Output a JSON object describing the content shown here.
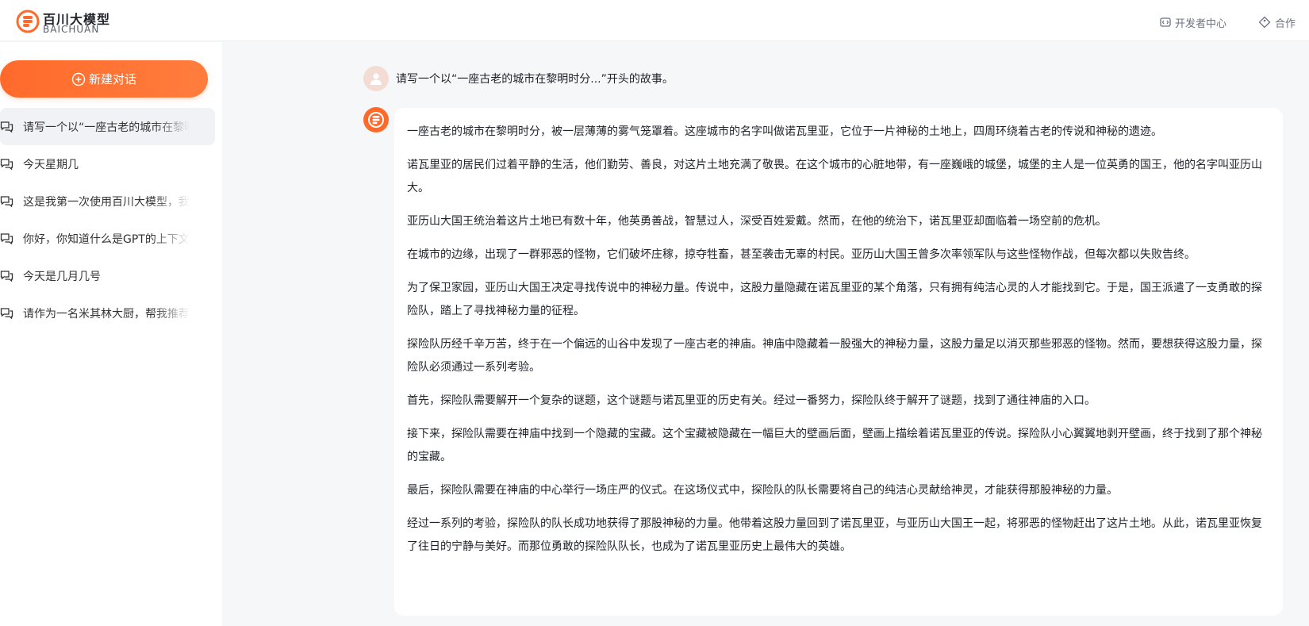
{
  "header": {
    "logo_cn": "百川大模型",
    "logo_en": "BAICHUAN",
    "dev_center": "开发者中心",
    "cooperation": "合作"
  },
  "sidebar": {
    "new_chat_label": "新建对话",
    "items": [
      {
        "label": "请写一个以“一座古老的城市在黎明时分...”开头的故事。",
        "active": true
      },
      {
        "label": "今天星期几",
        "active": false
      },
      {
        "label": "这是我第一次使用百川大模型，我",
        "active": false
      },
      {
        "label": "你好，你知道什么是GPT的上下文",
        "active": false
      },
      {
        "label": "今天是几月几号",
        "active": false
      },
      {
        "label": "请作为一名米其林大厨，帮我推荐",
        "active": false
      }
    ]
  },
  "conversation": {
    "user_message": "请写一个以“一座古老的城市在黎明时分...”开头的故事。",
    "answer_paragraphs": [
      "一座古老的城市在黎明时分，被一层薄薄的雾气笼罩着。这座城市的名字叫做诺瓦里亚，它位于一片神秘的土地上，四周环绕着古老的传说和神秘的遗迹。",
      "诺瓦里亚的居民们过着平静的生活，他们勤劳、善良，对这片土地充满了敬畏。在这个城市的心脏地带，有一座巍峨的城堡，城堡的主人是一位英勇的国王，他的名字叫亚历山大。",
      "亚历山大国王统治着这片土地已有数十年，他英勇善战，智慧过人，深受百姓爱戴。然而，在他的统治下，诺瓦里亚却面临着一场空前的危机。",
      "在城市的边缘，出现了一群邪恶的怪物，它们破坏庄稼，掠夺牲畜，甚至袭击无辜的村民。亚历山大国王曾多次率领军队与这些怪物作战，但每次都以失败告终。",
      "为了保卫家园，亚历山大国王决定寻找传说中的神秘力量。传说中，这股力量隐藏在诺瓦里亚的某个角落，只有拥有纯洁心灵的人才能找到它。于是，国王派遣了一支勇敢的探险队，踏上了寻找神秘力量的征程。",
      "探险队历经千辛万苦，终于在一个偏远的山谷中发现了一座古老的神庙。神庙中隐藏着一股强大的神秘力量，这股力量足以消灭那些邪恶的怪物。然而，要想获得这股力量，探险队必须通过一系列考验。",
      "首先，探险队需要解开一个复杂的谜题，这个谜题与诺瓦里亚的历史有关。经过一番努力，探险队终于解开了谜题，找到了通往神庙的入口。",
      "接下来，探险队需要在神庙中找到一个隐藏的宝藏。这个宝藏被隐藏在一幅巨大的壁画后面，壁画上描绘着诺瓦里亚的传说。探险队小心翼翼地剥开壁画，终于找到了那个神秘的宝藏。",
      "最后，探险队需要在神庙的中心举行一场庄严的仪式。在这场仪式中，探险队的队长需要将自己的纯洁心灵献给神灵，才能获得那股神秘的力量。",
      "经过一系列的考验，探险队的队长成功地获得了那股神秘的力量。他带着这股力量回到了诺瓦里亚，与亚历山大国王一起，将邪恶的怪物赶出了这片土地。从此，诺瓦里亚恢复了往日的宁静与美好。而那位勇敢的探险队队长，也成为了诺瓦里亚历史上最伟大的英雄。"
    ]
  },
  "colors": {
    "accent": "#ff6a2b",
    "sidebar_active": "#f1f2f5",
    "main_bg": "#f6f7f9"
  }
}
